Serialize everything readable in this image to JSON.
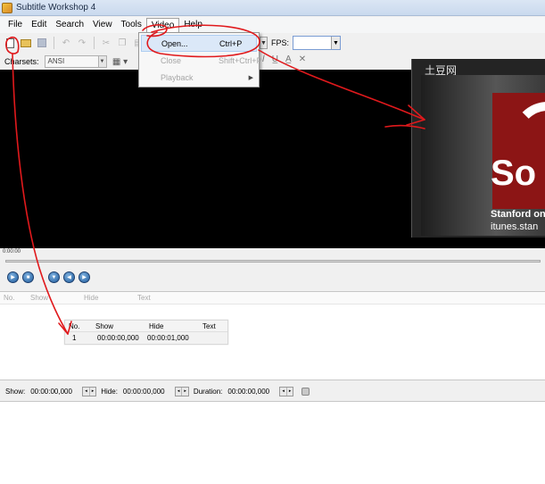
{
  "window": {
    "title": "Subtitle Workshop 4"
  },
  "menubar": {
    "items": [
      {
        "label": "File"
      },
      {
        "label": "Edit"
      },
      {
        "label": "Search"
      },
      {
        "label": "View"
      },
      {
        "label": "Tools"
      },
      {
        "label": "Video"
      },
      {
        "label": "Help"
      }
    ]
  },
  "video_menu": {
    "items": [
      {
        "label": "Open...",
        "shortcut": "Ctrl+P"
      },
      {
        "label": "Close",
        "shortcut": "Shift+Ctrl+P"
      },
      {
        "label": "Playback",
        "shortcut": ""
      }
    ]
  },
  "toolbar": {
    "fps_label": "FPS:",
    "fps_value": "",
    "charsets_label": "Charsets:",
    "charset_value": "ANSI"
  },
  "video": {
    "watermark": "土豆网",
    "logo_text": "So",
    "logo_line1": "Stanford on",
    "logo_line2": "itunes.stan"
  },
  "seek": {
    "time": "0:00:00",
    "position_fraction": 0
  },
  "subtitle_list": {
    "columns": [
      "No.",
      "Show",
      "Hide",
      "Text"
    ]
  },
  "zoom_table": {
    "columns": [
      "No.",
      "Show",
      "Hide",
      "Text"
    ],
    "rows": [
      {
        "no": "1",
        "show": "00:00:00,000",
        "hide": "00:00:01,000",
        "text": ""
      }
    ]
  },
  "timing": {
    "show_label": "Show:",
    "show_value": "00:00:00,000",
    "hide_label": "Hide:",
    "hide_value": "00:00:00,000",
    "duration_label": "Duration:",
    "duration_value": "00:00:00,000"
  },
  "colors": {
    "annotation": "#e0191c",
    "video_bg": "#000000",
    "stanford_red": "#8c1515",
    "menu_highlight": "#dbe8f8"
  }
}
